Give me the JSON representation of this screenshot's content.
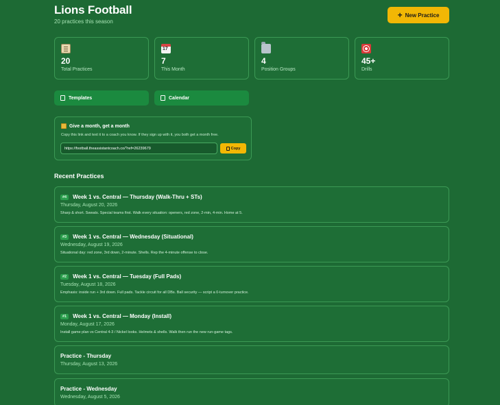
{
  "header": {
    "title": "Lions Football",
    "subtitle": "20 practices this season",
    "new_button": "New Practice",
    "new_button_icon": "plus-icon"
  },
  "stats": [
    {
      "icon": "clipboard-icon",
      "value": "20",
      "label": "Total Practices"
    },
    {
      "icon": "calendar-icon",
      "value": "7",
      "label": "This Month"
    },
    {
      "icon": "folder-icon",
      "value": "4",
      "label": "Position Groups"
    },
    {
      "icon": "target-icon",
      "value": "45+",
      "label": "Drills"
    }
  ],
  "tabs": [
    {
      "icon": "document-icon",
      "label": "Templates"
    },
    {
      "icon": "calendar-icon",
      "label": "Calendar"
    }
  ],
  "referral": {
    "icon": "gift-icon",
    "title": "Give a month, get a month",
    "description": "Copy this link and text it to a coach you know. If they sign up with it, you both get a month free.",
    "link": "https://football.theassistantcoach.co/?ref=26239679",
    "copy_label": "Copy"
  },
  "recent": {
    "heading": "Recent Practices",
    "items": [
      {
        "badge": "#4",
        "title": "Week 1 vs. Central — Thursday (Walk-Thru + STs)",
        "date": "Thursday, August 20, 2026",
        "desc": "Sharp & short. Sweats. Special teams first. Walk every situation: openers, red zone, 2-min, 4-min. Home at 5."
      },
      {
        "badge": "#3",
        "title": "Week 1 vs. Central — Wednesday (Situational)",
        "date": "Wednesday, August 19, 2026",
        "desc": "Situational day: red zone, 3rd down, 2-minute. Shells. Rep the 4-minute offense to close."
      },
      {
        "badge": "#2",
        "title": "Week 1 vs. Central — Tuesday (Full Pads)",
        "date": "Tuesday, August 18, 2026",
        "desc": "Emphasis: inside run + 3rd down. Full pads. Tackle circuit for all DBs. Ball security — script a 0-turnover practice."
      },
      {
        "badge": "#1",
        "title": "Week 1 vs. Central — Monday (Install)",
        "date": "Monday, August 17, 2026",
        "desc": "Install game plan vs Central 4-3 / Nickel looks. Helmets & shells. Walk then run the new run-game tags."
      },
      {
        "badge": "",
        "title": "Practice - Thursday",
        "date": "Thursday, August 13, 2026",
        "desc": ""
      },
      {
        "badge": "",
        "title": "Practice - Wednesday",
        "date": "Wednesday, August 5, 2026",
        "desc": ""
      }
    ]
  }
}
